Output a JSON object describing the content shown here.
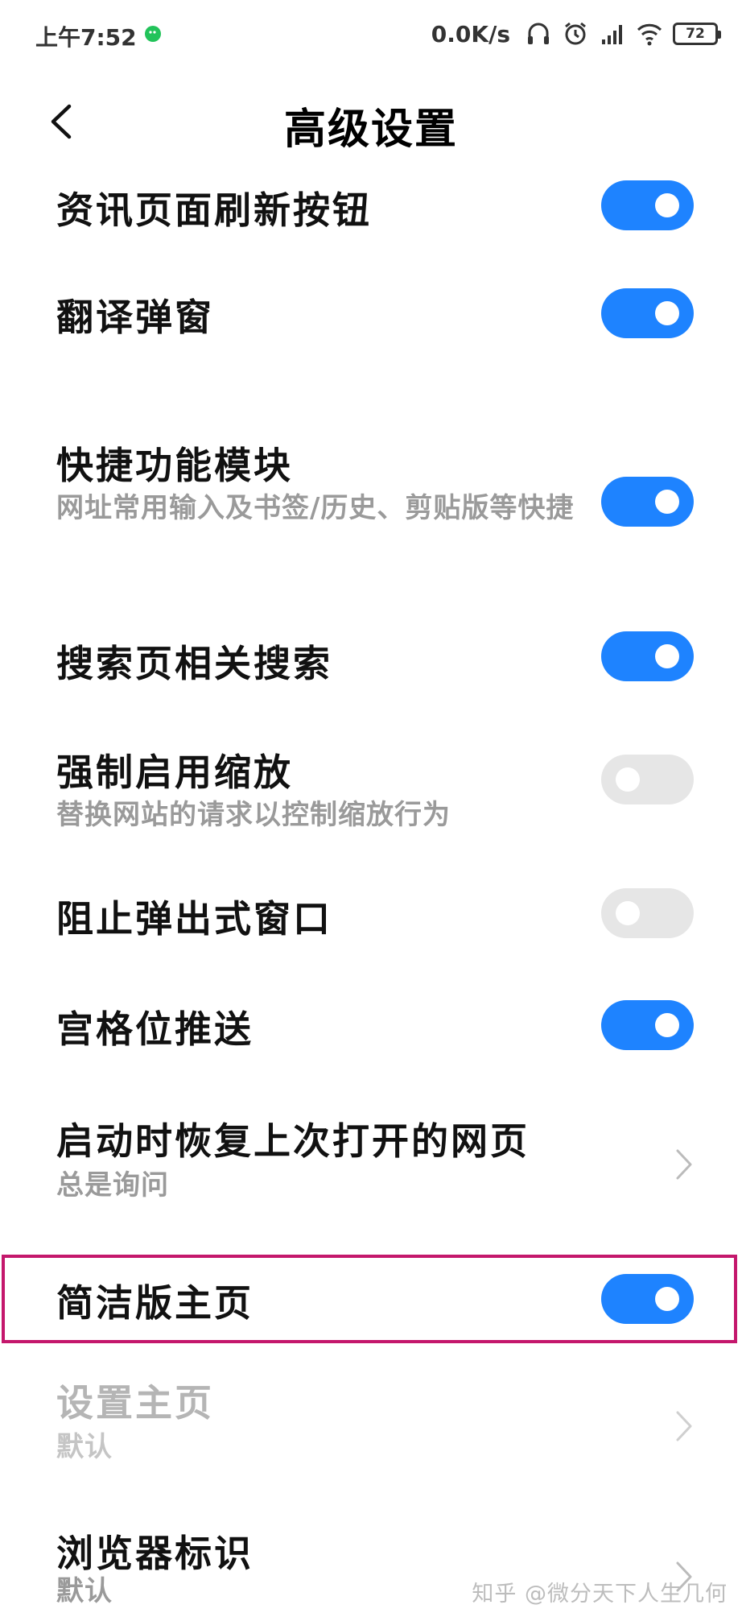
{
  "status_bar": {
    "time": "上午7:52",
    "net_speed": "0.0K/s",
    "battery": "72",
    "icons": [
      "wechat-icon",
      "headset-icon",
      "alarm-icon",
      "signal-icon",
      "wifi-icon",
      "battery-icon"
    ]
  },
  "header": {
    "title": "高级设置",
    "back_icon": "chevron-left-icon"
  },
  "settings": [
    {
      "title": "资讯页面刷新按钮",
      "control": "toggle",
      "on": true
    },
    {
      "title": "翻译弹窗",
      "control": "toggle",
      "on": true
    },
    {
      "title": "快捷功能模块",
      "subtitle": "网址常用输入及书签/历史、剪贴版等快捷",
      "control": "toggle",
      "on": true
    },
    {
      "title": "搜索页相关搜索",
      "control": "toggle",
      "on": true
    },
    {
      "title": "强制启用缩放",
      "subtitle": "替换网站的请求以控制缩放行为",
      "control": "toggle",
      "on": false
    },
    {
      "title": "阻止弹出式窗口",
      "control": "toggle",
      "on": false
    },
    {
      "title": "宫格位推送",
      "control": "toggle",
      "on": true
    },
    {
      "title": "启动时恢复上次打开的网页",
      "subtitle": "总是询问",
      "control": "chevron"
    },
    {
      "title": "简洁版主页",
      "control": "toggle",
      "on": true,
      "highlighted": true
    },
    {
      "title": "设置主页",
      "subtitle": "默认",
      "control": "chevron",
      "disabled": true
    },
    {
      "title": "浏览器标识",
      "subtitle": "默认",
      "control": "chevron"
    }
  ],
  "watermark": "知乎 @微分天下人生几何",
  "colors": {
    "toggle_on": "#1e83ff",
    "toggle_off": "#e6e6e6",
    "highlight_border": "#c4176c"
  }
}
